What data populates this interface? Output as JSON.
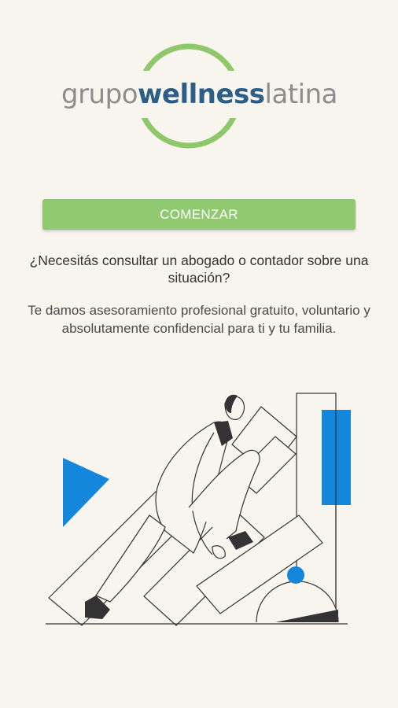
{
  "brand": {
    "part1": "grupo",
    "part2": "wellness",
    "part3": "latina",
    "ring_color": "#8fc76b",
    "primary_color": "#2d5f86",
    "secondary_color": "#8d8d8d"
  },
  "cta": {
    "label": "COMENZAR",
    "color": "#90c970"
  },
  "content": {
    "question": "¿Necesitás consultar un abogado o contador sobre una situación?",
    "description": "Te damos asesoramiento profesional gratuito, voluntario y absolutamente confidencial para ti y tu familia."
  },
  "illustration": {
    "accent_color": "#1486dc",
    "line_color": "#333333"
  }
}
